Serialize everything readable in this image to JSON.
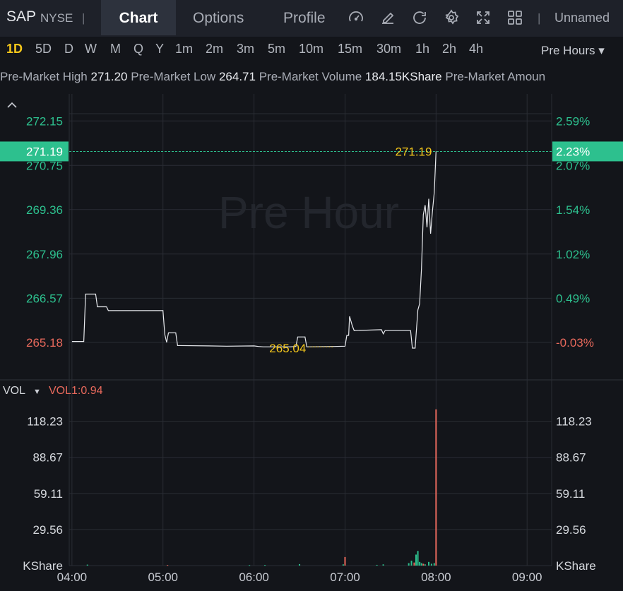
{
  "header": {
    "symbol": "SAP",
    "exchange": "NYSE",
    "separator": "|",
    "tabs": [
      {
        "label": "Chart",
        "active": true
      },
      {
        "label": "Options",
        "active": false
      },
      {
        "label": "Profile",
        "active": false
      }
    ],
    "tools": [
      "gauge-icon",
      "pencil-icon",
      "refresh-icon",
      "gear-icon",
      "fullscreen-icon",
      "grid-icon"
    ],
    "layout_name": "Unnamed"
  },
  "periods": {
    "items": [
      "1D",
      "5D",
      "D",
      "W",
      "M",
      "Q",
      "Y",
      "1m",
      "2m",
      "3m",
      "5m",
      "10m",
      "15m",
      "30m",
      "1h",
      "2h",
      "4h"
    ],
    "active": "1D",
    "session_label": "Pre Hours ▾"
  },
  "stats": {
    "high_label": "Pre-Market High",
    "high_value": "271.20",
    "low_label": "Pre-Market Low",
    "low_value": "264.71",
    "volume_label": "Pre-Market Volume",
    "volume_value": "184.15KShare",
    "amount_label": "Pre-Market Amoun"
  },
  "volume_panel": {
    "label": "VOL",
    "indicator": "VOL1:0.94"
  },
  "colors": {
    "background": "#13151a",
    "grid": "#2a2d34",
    "up": "#2dc08e",
    "down": "#e8695c",
    "accent": "#f5c71a",
    "price_line": "#e8eaee"
  },
  "chart_data": [
    {
      "type": "line",
      "watermark": "Pre Hour",
      "x_ticks": [
        "04:00",
        "05:00",
        "06:00",
        "07:00",
        "08:00",
        "09:00"
      ],
      "y_ticks": [
        "272.15",
        "270.75",
        "269.36",
        "267.96",
        "266.57",
        "265.18"
      ],
      "y_ticks_right": [
        "2.59%",
        "2.07%",
        "1.54%",
        "1.02%",
        "0.49%",
        "-0.03%"
      ],
      "ylim": [
        264.0,
        273.0
      ],
      "xlim": [
        3.97,
        9.27
      ],
      "base_price": 265.26,
      "last_price": "271.19",
      "last_change": "2.23%",
      "high_marker": "271.19",
      "low_marker": "265.04",
      "low_marker_x": 6.37,
      "low_marker_y": 265.04,
      "high_marker_x": 7.52,
      "high_marker_y": 271.19,
      "series": [
        {
          "x": [
            4.0,
            4.13,
            4.15,
            4.26,
            4.28,
            4.38,
            4.4,
            5.0,
            5.02,
            5.04,
            5.06,
            5.14,
            5.16,
            5.5,
            5.7,
            6.0,
            6.05,
            6.1,
            6.4,
            6.46,
            6.48,
            6.56,
            6.58,
            6.88,
            7.0,
            7.02,
            7.04,
            7.05,
            7.08,
            7.1,
            7.4,
            7.42,
            7.44,
            7.46,
            7.72,
            7.74,
            7.77,
            7.8,
            7.82,
            7.84,
            7.86,
            7.88,
            7.9,
            7.92,
            7.94,
            7.96,
            7.98,
            8.0
          ],
          "y": [
            265.21,
            265.21,
            266.7,
            266.7,
            266.3,
            266.3,
            266.18,
            266.18,
            265.43,
            265.18,
            265.48,
            265.48,
            265.08,
            265.07,
            265.06,
            265.07,
            265.05,
            265.04,
            265.04,
            265.05,
            265.35,
            265.35,
            265.04,
            265.05,
            265.06,
            265.4,
            265.4,
            266.0,
            265.7,
            265.55,
            265.58,
            265.45,
            265.55,
            265.55,
            265.55,
            265.0,
            265.0,
            266.2,
            266.4,
            267.5,
            269.2,
            269.5,
            268.8,
            269.7,
            268.6,
            269.3,
            269.9,
            271.19
          ]
        }
      ]
    },
    {
      "type": "bar",
      "name": "VOL",
      "unit": "KShare",
      "y_ticks": [
        "118.23",
        "88.67",
        "59.11",
        "29.56",
        "KShare"
      ],
      "ylim": [
        0,
        140
      ],
      "xlim": [
        3.97,
        9.27
      ],
      "x": [
        4.17,
        5.05,
        5.95,
        6.12,
        6.5,
        6.98,
        7.0,
        7.35,
        7.42,
        7.7,
        7.73,
        7.76,
        7.78,
        7.8,
        7.82,
        7.84,
        7.86,
        7.88,
        7.92,
        7.95,
        7.98,
        8.0
      ],
      "values": [
        0.8,
        0.5,
        0.4,
        0.5,
        1.2,
        1.0,
        7.0,
        0.6,
        1.0,
        2.0,
        4.0,
        2.5,
        9.0,
        12.0,
        3.0,
        2.0,
        1.5,
        1.0,
        3.0,
        1.5,
        2.0,
        128.0
      ]
    }
  ]
}
